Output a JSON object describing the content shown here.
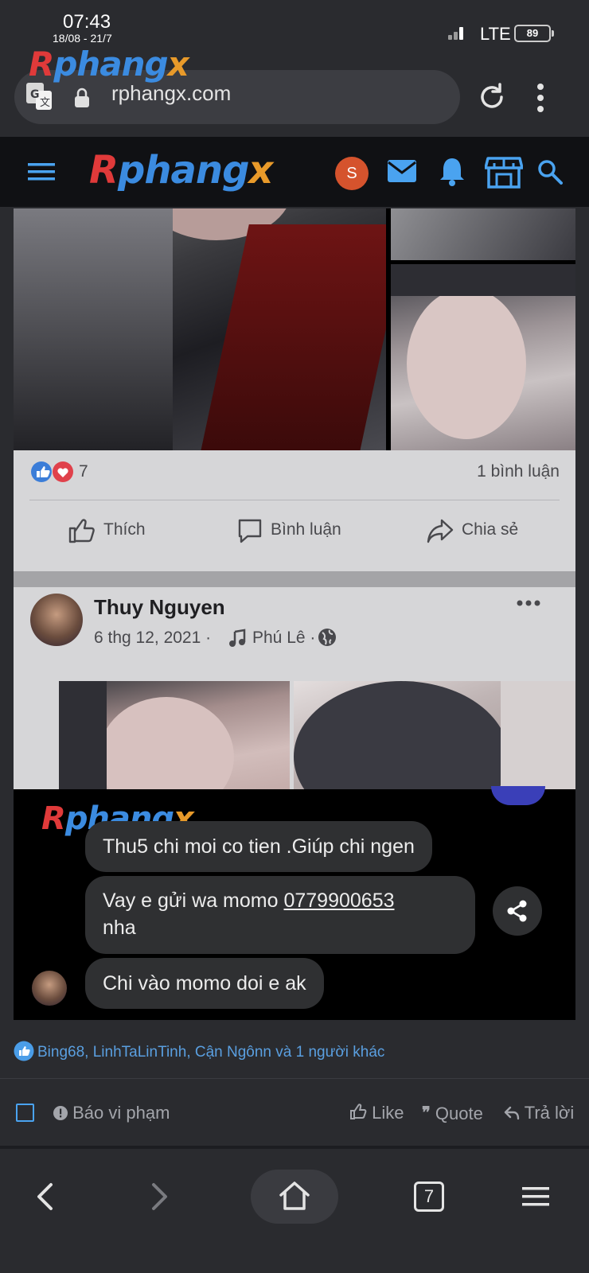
{
  "status_bar": {
    "time": "07:43",
    "date_range": "18/08 - 21/7",
    "network": "LTE",
    "battery": "89"
  },
  "browser": {
    "url": "rphangx.com",
    "watermark": "Rphangx"
  },
  "site": {
    "logo": {
      "part1": "R",
      "part2": "phang",
      "part3": "x"
    },
    "user_initial": "S",
    "colors": {
      "accent": "#3b8be0",
      "avatar": "#d5532d"
    }
  },
  "post": {
    "fb_card1": {
      "reaction_count": "7",
      "comment_count": "1 bình luận",
      "like_label": "Thích",
      "comment_label": "Bình luận",
      "share_label": "Chia sẻ"
    },
    "fb_card2": {
      "author": "Thuy Nguyen",
      "meta_date": "6 thg 12, 2021 ·",
      "meta_place": "Phú Lê ·"
    },
    "chat": {
      "watermark": "Rphangx",
      "messages": [
        "Thu5 chi moi co tien .Giúp chi ngen",
        "Vay e gửi wa momo ",
        "Chi vào momo doi e ak"
      ],
      "phone": "0779900653",
      "msg2_tail": "nha"
    }
  },
  "reactions": {
    "text": "Bing68, LinhTaLinTinh, Cận Ngônn và 1 người khác"
  },
  "post_actions": {
    "report": "Báo vi phạm",
    "like": "Like",
    "quote": "Quote",
    "reply": "Trả lời"
  },
  "bottom_nav": {
    "tabs_count": "7"
  }
}
